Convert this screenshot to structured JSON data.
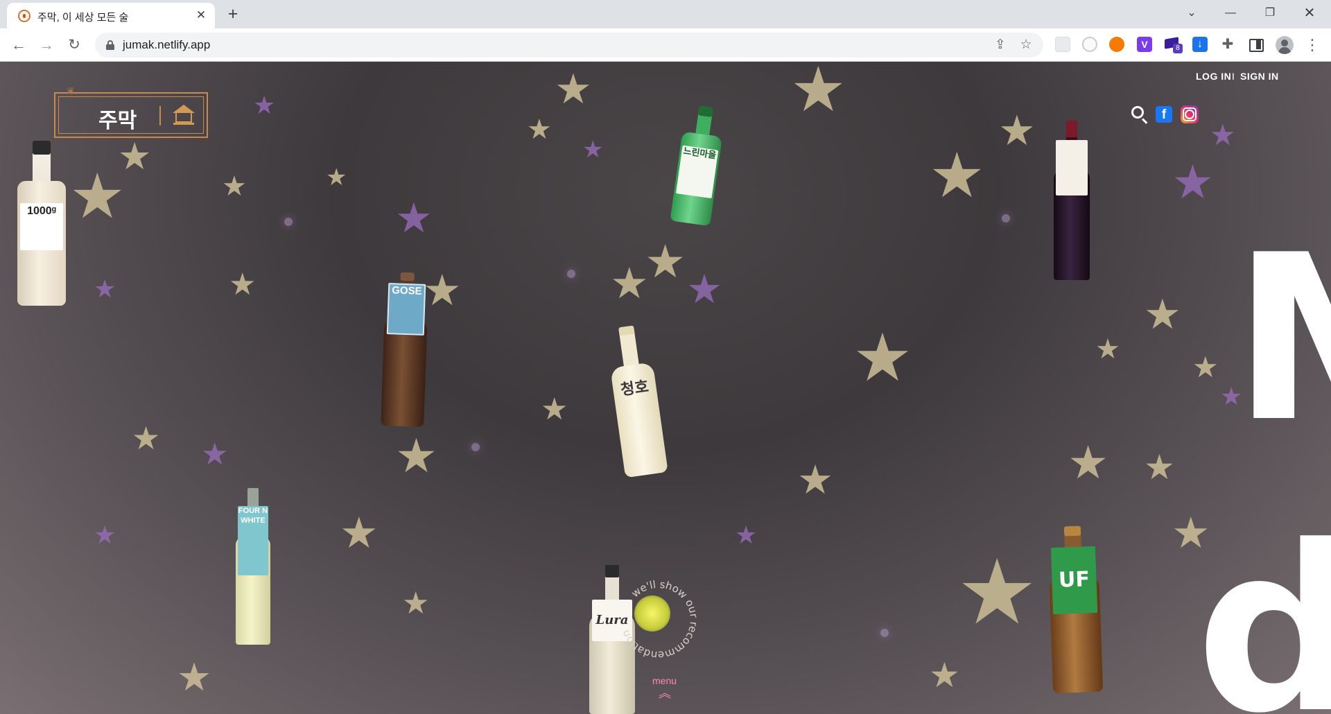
{
  "browser": {
    "tab_title": "주막, 이 세상 모든 술",
    "url": "jumak.netlify.app",
    "extension_badge": "8"
  },
  "page": {
    "logo_text": "주막",
    "auth": {
      "login": "LOG IN",
      "separator": "I",
      "signin": "SIGN IN"
    },
    "side_text_top": "M",
    "side_text_bottom": "dk",
    "recommend_text": "we'll show our recommendation",
    "menu_label": "menu",
    "menu_chevron": "«"
  },
  "bottles": {
    "makgeolli": "1000ᵍ",
    "green": "느린마을",
    "gose": "GOSE",
    "cheongju": "청호",
    "fourn": "FOUR N WHITE",
    "lura": "Lura",
    "uf": "UF"
  }
}
